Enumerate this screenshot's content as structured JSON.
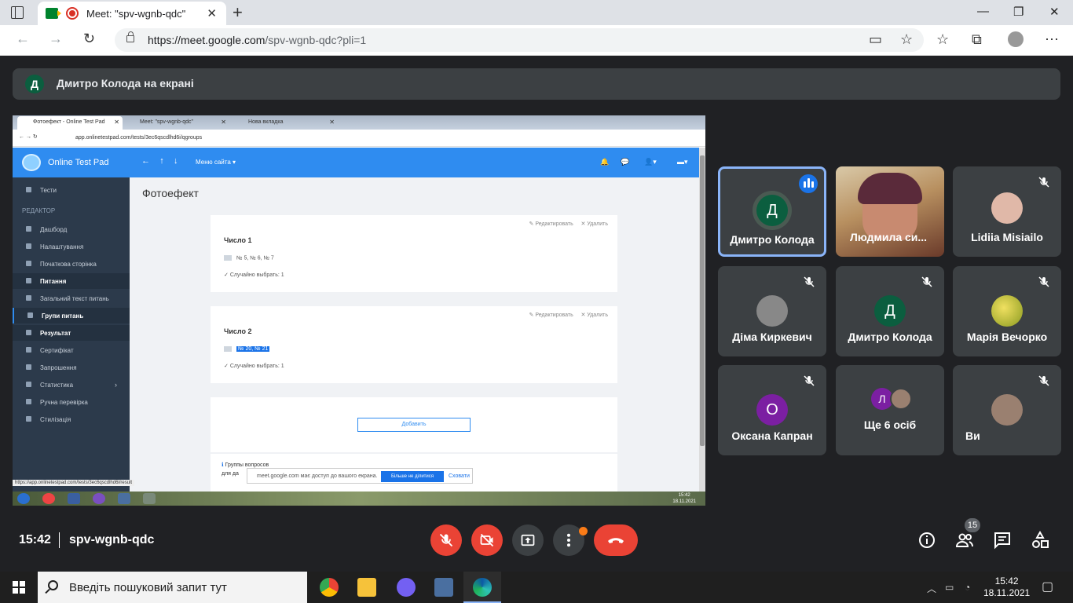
{
  "browser": {
    "tab_title": "Meet: \"spv-wgnb-qdc\"",
    "url_host": "https://meet.google.com",
    "url_path": "/spv-wgnb-qdc?pli=1"
  },
  "banner": {
    "avatar_letter": "Д",
    "text": "Дмитро Колода на екрані"
  },
  "shared": {
    "tabs": [
      "Фотоефект - Online Test Pad",
      "Meet: \"spv-wgnb-qdc\"",
      "Нова вкладка"
    ],
    "url": "app.onlinetestpad.com/tests/3ec6qscdlhd6i/qgroups",
    "brand": "Online Test Pad",
    "site_menu": "Меню сайта",
    "sidebar_heading": "РЕДАКТОР",
    "sidebar": [
      "Тести",
      "Дашборд",
      "Налаштування",
      "Початкова сторінка",
      "Питання",
      "Загальний текст питань",
      "Групи питань",
      "Результат",
      "Сертифікат",
      "Запрошення",
      "Статистика",
      "Ручна перевірка",
      "Стилізація"
    ],
    "page_title": "Фотоефект",
    "edit_label": "Редактировать",
    "delete_label": "Удалить",
    "group1_title": "Число 1",
    "group1_items": "№ 5, № 6, № 7",
    "group1_random": "Случайно выбрать: 1",
    "group2_title": "Число 2",
    "group2_items": "№ 20, № 21",
    "group2_random": "Случайно выбрать: 1",
    "add_button": "Добавить",
    "footnote_start": "Группы вопросов",
    "footnote_end": "для да",
    "status_url": "https://app.onlinetestpad.com/tests/3ec6qscdlhd6i/result",
    "share_notice": "meet.google.com має доступ до вашого екрана.",
    "stop_sharing": "Більше не ділитися",
    "hide": "Сховати",
    "time": "15:42",
    "date": "18.11.2021"
  },
  "participants": [
    {
      "name": "Дмитро Колода",
      "initial": "Д",
      "color": "#0b5e3f",
      "active": true
    },
    {
      "name": "Людмила си...",
      "initial": "",
      "color": "#7a6a5a",
      "video": true
    },
    {
      "name": "Lidiia Misiailo",
      "initial": "",
      "color": "#e0b8a8"
    },
    {
      "name": "Діма Киркевич",
      "initial": "",
      "color": "#888888"
    },
    {
      "name": "Дмитро Колода",
      "initial": "Д",
      "color": "#0b5e3f"
    },
    {
      "name": "Марія Вечорко",
      "initial": "",
      "color": "#c8c020"
    },
    {
      "name": "Оксана Капран",
      "initial": "О",
      "color": "#7b1fa2"
    },
    {
      "name": "Ще 6 осіб",
      "initial": "Л",
      "color": "#7b1fa2"
    },
    {
      "name": "Ви",
      "initial": "",
      "color": "#9a8070"
    }
  ],
  "meet_bar": {
    "time": "15:42",
    "meeting_code": "spv-wgnb-qdc",
    "people_count": "15"
  },
  "taskbar": {
    "search_placeholder": "Введіть пошуковий запит тут",
    "time": "15:42",
    "date": "18.11.2021"
  }
}
